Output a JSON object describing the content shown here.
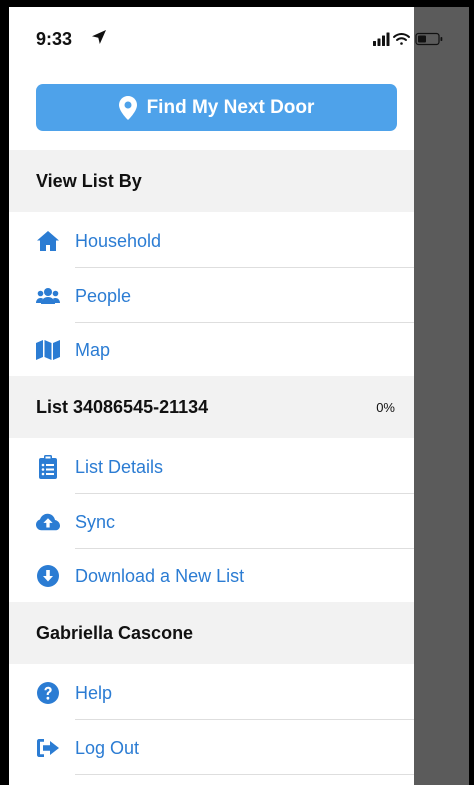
{
  "status_bar": {
    "time": "9:33"
  },
  "find_button": {
    "label": "Find My Next Door"
  },
  "view_section": {
    "title": "View List By"
  },
  "view_items": [
    {
      "label": "Household",
      "icon": "home-icon"
    },
    {
      "label": "People",
      "icon": "users-icon"
    },
    {
      "label": "Map",
      "icon": "map-icon"
    }
  ],
  "list_section": {
    "title": "List 34086545-21134",
    "percent": "0%"
  },
  "list_items": [
    {
      "label": "List Details",
      "icon": "clipboard-icon"
    },
    {
      "label": "Sync",
      "icon": "cloud-upload-icon"
    },
    {
      "label": "Download a New List",
      "icon": "download-circle-icon"
    }
  ],
  "user_section": {
    "title": "Gabriella Cascone"
  },
  "user_items": [
    {
      "label": "Help",
      "icon": "help-circle-icon"
    },
    {
      "label": "Log Out",
      "icon": "logout-icon"
    }
  ],
  "colors": {
    "accent": "#2b7cd3",
    "button": "#4ea2ea",
    "section_bg": "#f2f2f2",
    "overlay": "#5b5b5b"
  }
}
